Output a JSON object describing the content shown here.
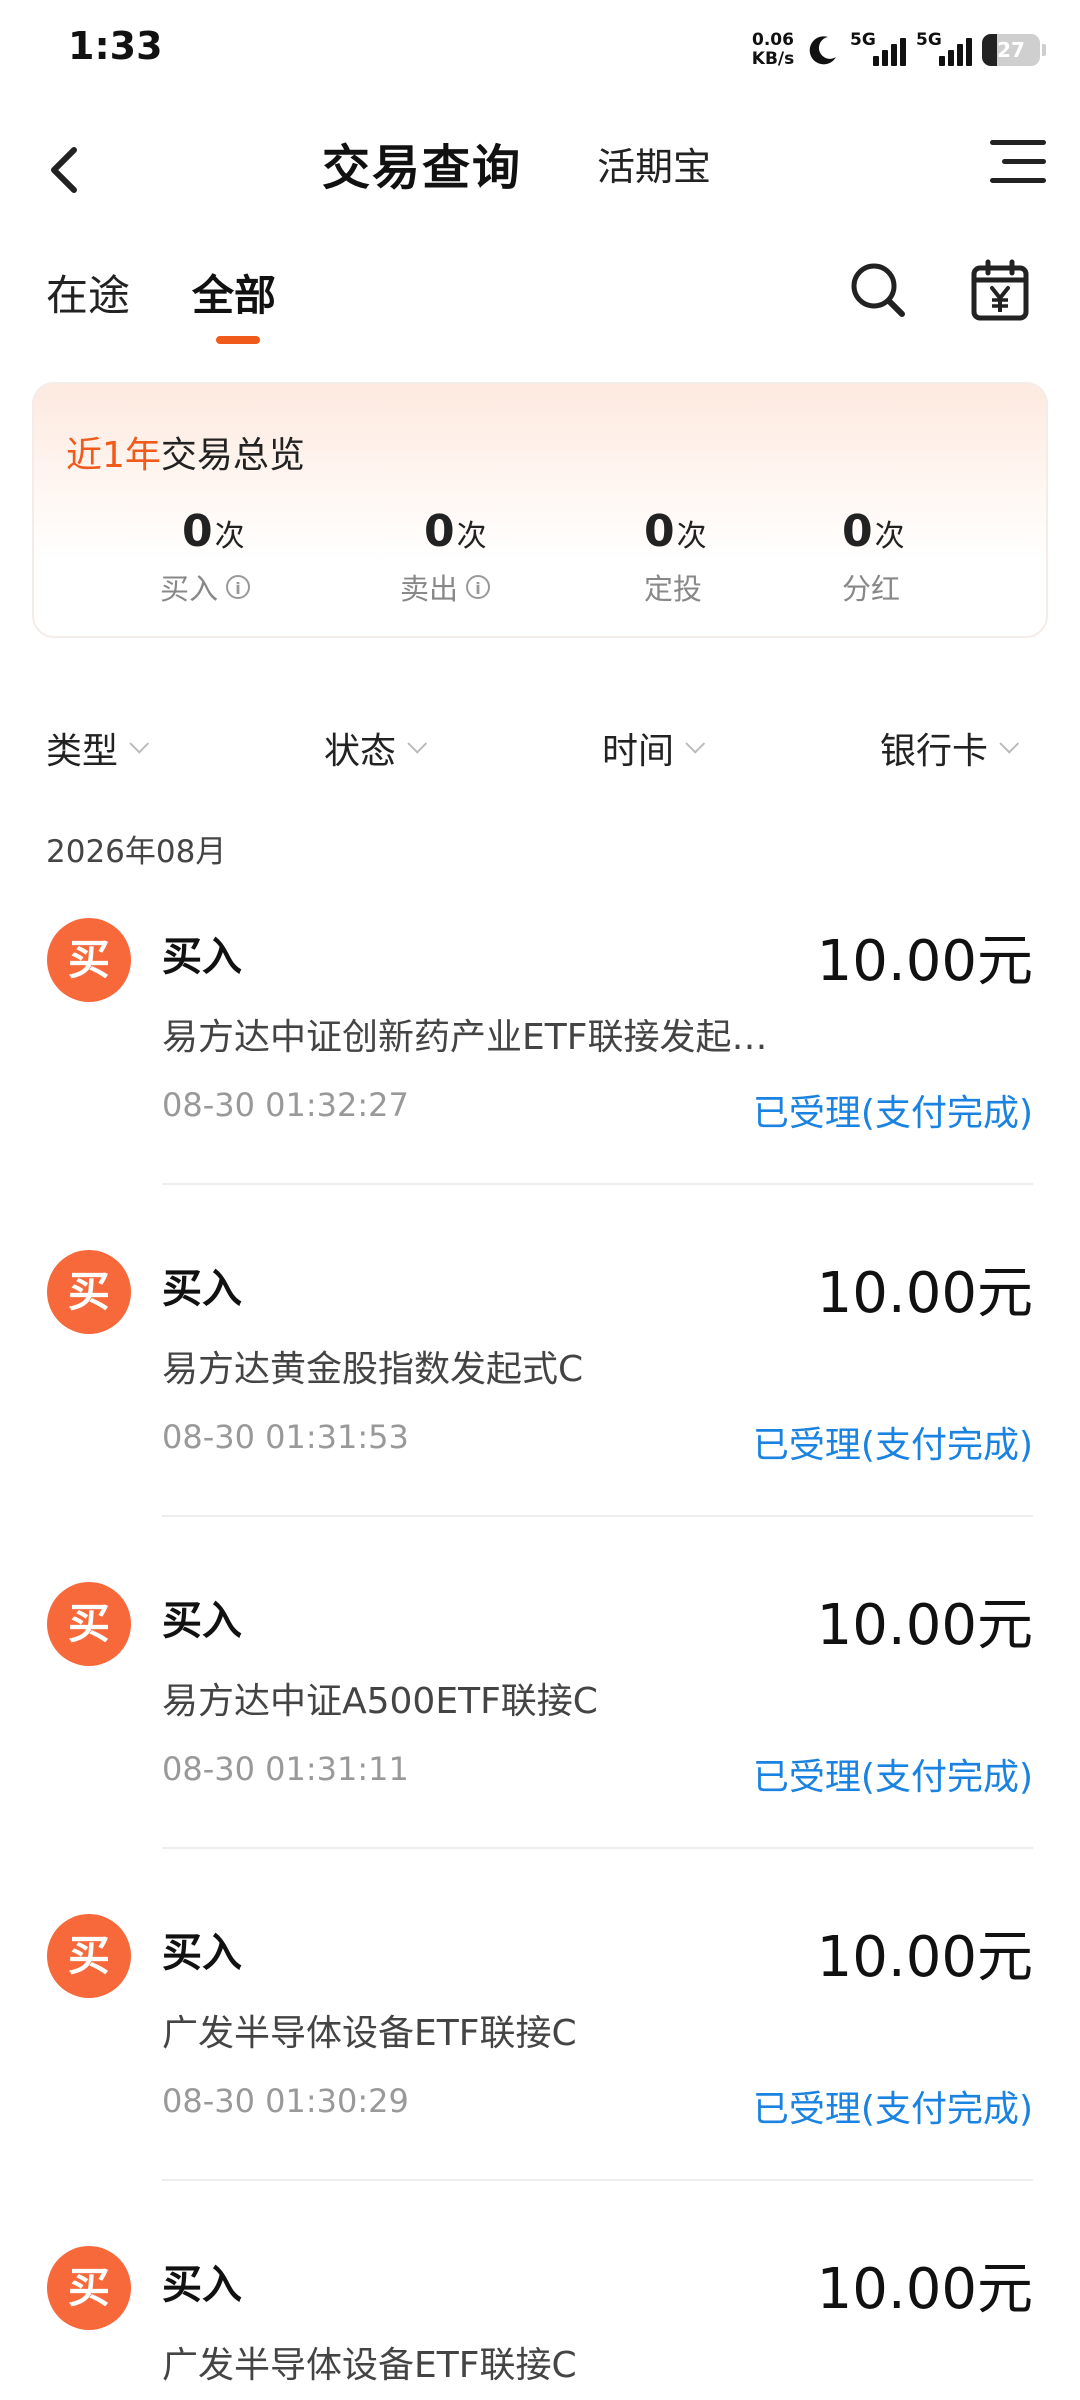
{
  "status_bar": {
    "time": "1:33",
    "net_speed_value": "0.06",
    "net_speed_unit": "KB/s",
    "sim1_label": "5G",
    "sim2_label": "5G",
    "battery": "27"
  },
  "nav": {
    "title": "交易查询",
    "subtitle": "活期宝"
  },
  "tabs": [
    {
      "label": "在途",
      "active": false
    },
    {
      "label": "全部",
      "active": true
    }
  ],
  "summary": {
    "title_highlight": "近1年",
    "title_rest": "交易总览",
    "stats": [
      {
        "count": "0",
        "unit": "次",
        "label": "买入"
      },
      {
        "count": "0",
        "unit": "次",
        "label": "卖出"
      },
      {
        "count": "0",
        "unit": "次",
        "label": "定投"
      },
      {
        "count": "0",
        "unit": "次",
        "label": "分红"
      }
    ]
  },
  "filters": [
    {
      "label": "类型"
    },
    {
      "label": "状态"
    },
    {
      "label": "时间"
    },
    {
      "label": "银行卡"
    }
  ],
  "month_header": "2026年08月",
  "records": [
    {
      "icon_text": "买",
      "type": "买入",
      "amount": "10.00元",
      "fund_name": "易方达中证创新药产业ETF联接发起…",
      "time": "08-30 01:32:27",
      "status": "已受理(支付完成)"
    },
    {
      "icon_text": "买",
      "type": "买入",
      "amount": "10.00元",
      "fund_name": "易方达黄金股指数发起式C",
      "time": "08-30 01:31:53",
      "status": "已受理(支付完成)"
    },
    {
      "icon_text": "买",
      "type": "买入",
      "amount": "10.00元",
      "fund_name": "易方达中证A500ETF联接C",
      "time": "08-30 01:31:11",
      "status": "已受理(支付完成)"
    },
    {
      "icon_text": "买",
      "type": "买入",
      "amount": "10.00元",
      "fund_name": "广发半导体设备ETF联接C",
      "time": "08-30 01:30:29",
      "status": "已受理(支付完成)"
    },
    {
      "icon_text": "买",
      "type": "买入",
      "amount": "10.00元",
      "fund_name": "广发半导体设备ETF联接C",
      "time": "",
      "status": ""
    }
  ],
  "colors": {
    "accent": "#f05a1a",
    "icon_bg": "#f7683a",
    "status_blue": "#1a82e0"
  }
}
